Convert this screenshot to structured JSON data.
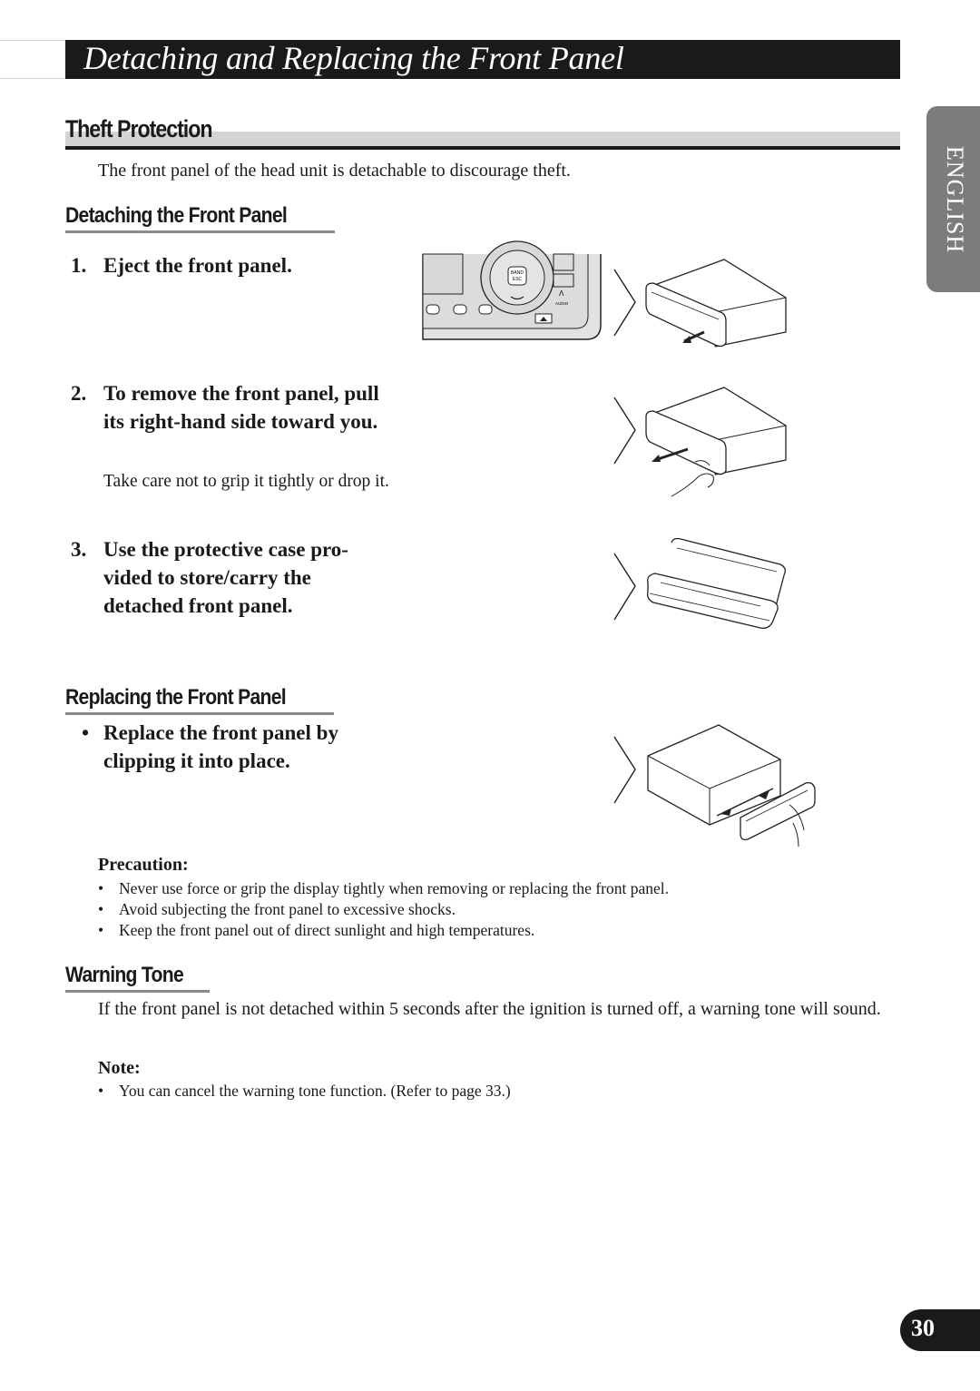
{
  "header": {
    "title": "Detaching and Replacing the Front Panel"
  },
  "side_tab": {
    "label": "ENGLISH"
  },
  "theft_protection": {
    "heading": "Theft Protection",
    "intro": "The front panel of the head unit is detachable to discourage theft."
  },
  "detaching": {
    "heading": "Detaching the Front Panel",
    "steps": [
      {
        "number": "1.",
        "text": "Eject the front panel.",
        "note": ""
      },
      {
        "number": "2.",
        "text": "To remove the front panel, pull its right-hand side toward you.",
        "note": "Take care not to grip it tightly or drop it."
      },
      {
        "number": "3.",
        "text": "Use the protective case pro-vided to store/carry the detached front panel.",
        "note": ""
      }
    ],
    "illustration_labels": {
      "band_button": "BAND ESC",
      "audio_button": "AUDIO"
    }
  },
  "replacing": {
    "heading": "Replacing the Front Panel",
    "bullet": "Replace the front panel by clipping it into place."
  },
  "precaution": {
    "label": "Precaution:",
    "items": [
      "Never use force or grip the display tightly when removing or replacing the front panel.",
      "Avoid subjecting the front panel to excessive shocks.",
      "Keep the front panel out of direct sunlight and high temperatures."
    ]
  },
  "warning_tone": {
    "heading": "Warning Tone",
    "text": "If the front panel is not detached within 5 seconds after the ignition is turned off, a warning tone will sound.",
    "note_label": "Note:",
    "notes": [
      "You can cancel the warning tone function. (Refer to page 33.)"
    ]
  },
  "footer": {
    "page_number": "30"
  },
  "bullet_glyph": "•"
}
